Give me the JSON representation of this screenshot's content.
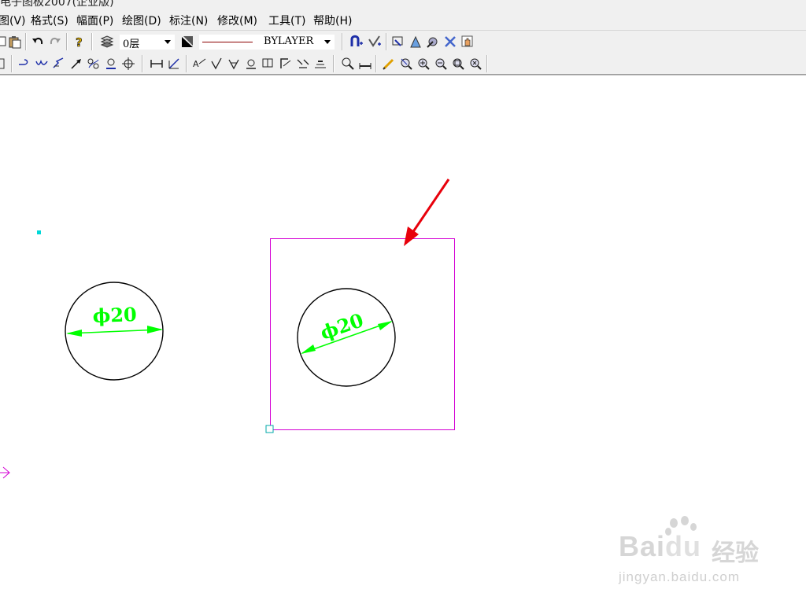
{
  "window": {
    "title": "电子图板2007(企业版)"
  },
  "menubar": {
    "items": [
      "图(V)",
      "格式(S)",
      "幅面(P)",
      "绘图(D)",
      "标注(N)",
      "修改(M)",
      "工具(T)",
      "帮助(H)"
    ]
  },
  "toolbar": {
    "layer_value": "0层",
    "linetype_value": "BYLAYER",
    "linetype_color": "#8b0000"
  },
  "drawing": {
    "dimension_left": "ϕ20",
    "dimension_right": "ϕ20",
    "dimension_color": "#00ff00",
    "frame_color": "#d400d4",
    "arrow_color": "#e8000b"
  },
  "watermark": {
    "brand": "Bai",
    "brand_suffix": "du",
    "service": "经验",
    "url": "jingyan.baidu.com"
  }
}
